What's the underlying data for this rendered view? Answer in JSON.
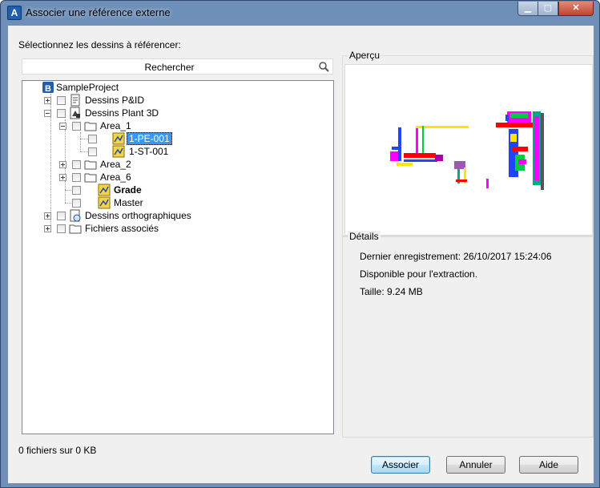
{
  "window": {
    "title": "Associer une référence externe",
    "app_icon_letter": "A"
  },
  "instructions": "Sélectionnez les dessins à référencer:",
  "search": {
    "placeholder": "Rechercher"
  },
  "tree": {
    "root": "SampleProject",
    "pid": "Dessins P&ID",
    "plant3d": "Dessins Plant 3D",
    "area1": "Area_1",
    "pe001": "1-PE-001",
    "st001": "1-ST-001",
    "area2": "Area_2",
    "area6": "Area_6",
    "grade": "Grade",
    "master": "Master",
    "ortho": "Dessins orthographiques",
    "related": "Fichiers associés"
  },
  "preview": {
    "title": "Aperçu"
  },
  "details": {
    "title": "Détails",
    "last_saved": "Dernier enregistrement: 26/10/2017 15:24:06",
    "availability": "Disponible pour l'extraction.",
    "size": "Taille: 9.24 MB"
  },
  "status": "0 fichiers sur 0 KB",
  "buttons": {
    "attach": "Associer",
    "cancel": "Annuler",
    "help": "Aide"
  },
  "colors": {
    "selection": "#3399ff",
    "title_bar": "#6d8fb8",
    "default_button_border": "#3c7fb1"
  }
}
